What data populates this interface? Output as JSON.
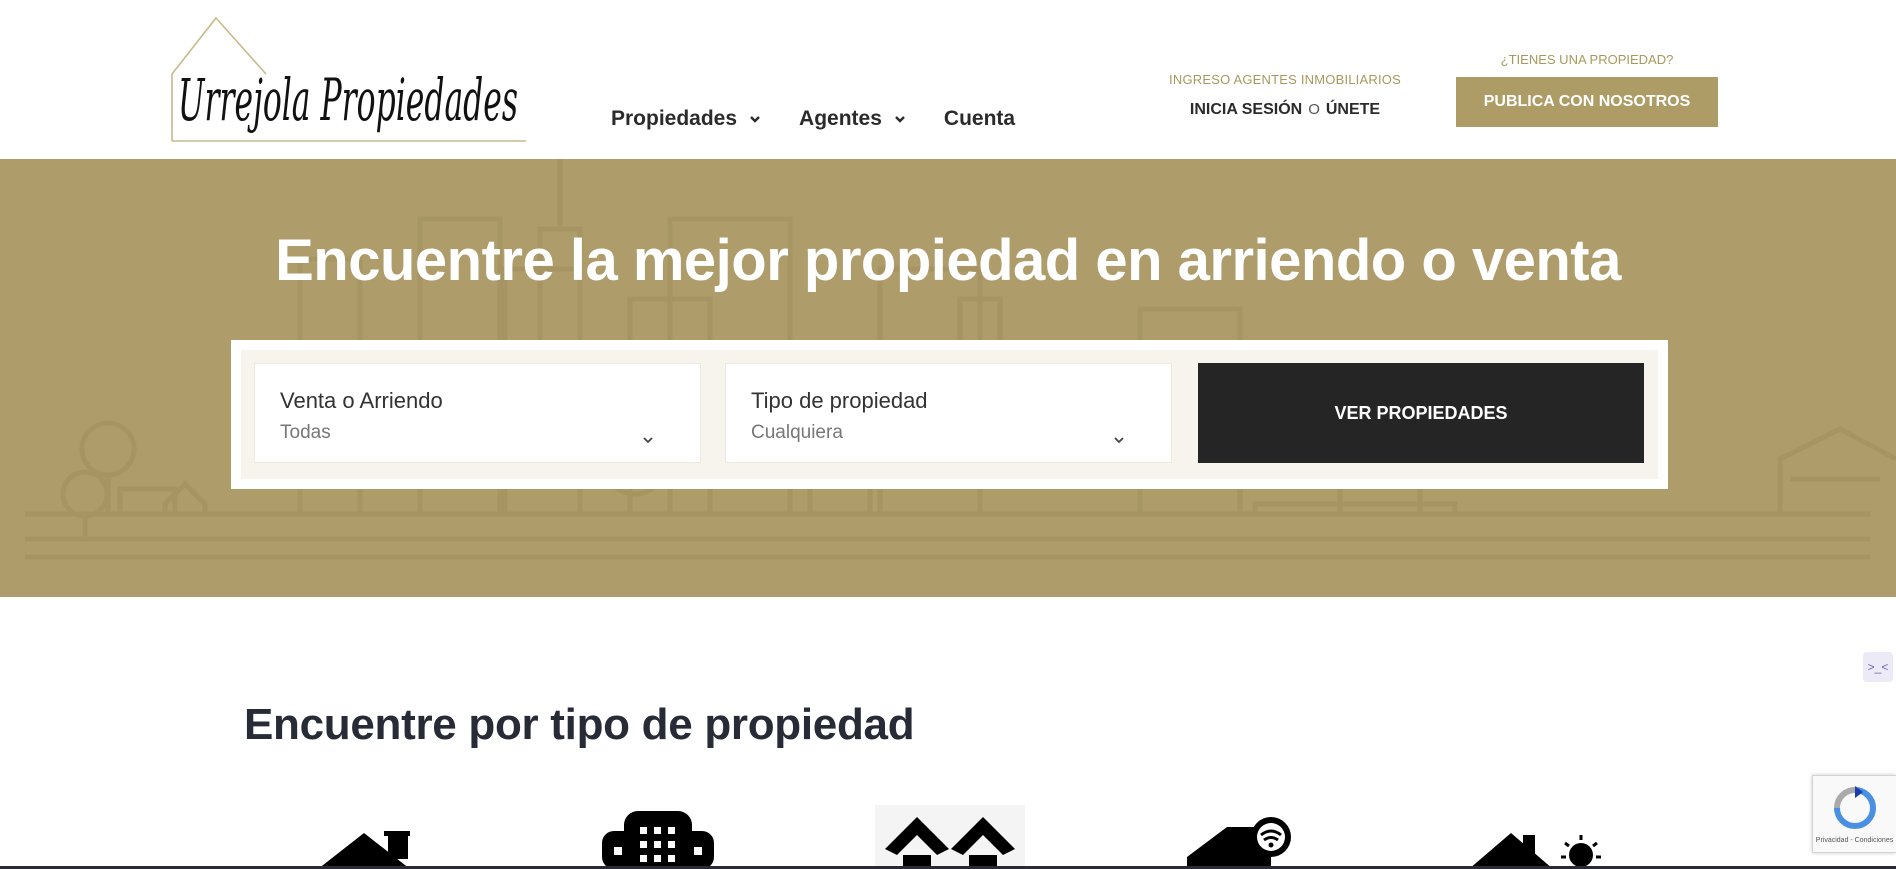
{
  "header": {
    "logo_text": "Urrejola Propiedades",
    "nav": [
      {
        "label": "Propiedades",
        "has_dropdown": true
      },
      {
        "label": "Agentes",
        "has_dropdown": true
      },
      {
        "label": "Cuenta",
        "has_dropdown": false
      }
    ],
    "agents": {
      "label": "INGRESO AGENTES INMOBILIARIOS",
      "login": "INICIA SESIÓN",
      "or": "O",
      "join": "ÚNETE"
    },
    "publish": {
      "question": "¿TIENES UNA PROPIEDAD?",
      "button": "PUBLICA CON NOSOTROS"
    }
  },
  "hero": {
    "title": "Encuentre la mejor propiedad en arriendo o venta",
    "search": {
      "operation": {
        "label": "Venta o Arriendo",
        "value": "Todas"
      },
      "type": {
        "label": "Tipo de propiedad",
        "value": "Cualquiera"
      },
      "button": "VER PROPIEDADES"
    }
  },
  "section": {
    "title": "Encuentre por tipo de propiedad",
    "icons": [
      "house-icon",
      "apartment-building-icon",
      "townhouses-icon",
      "smart-home-icon",
      "country-house-icon"
    ]
  },
  "widgets": {
    "side_tab": ">_<",
    "recaptcha_text": "Privacidad - Condiciones"
  },
  "colors": {
    "brand_gold": "#ad9c65",
    "hero_bg": "#ae9d6a",
    "dark_button": "#252525",
    "heading": "#262b36"
  }
}
